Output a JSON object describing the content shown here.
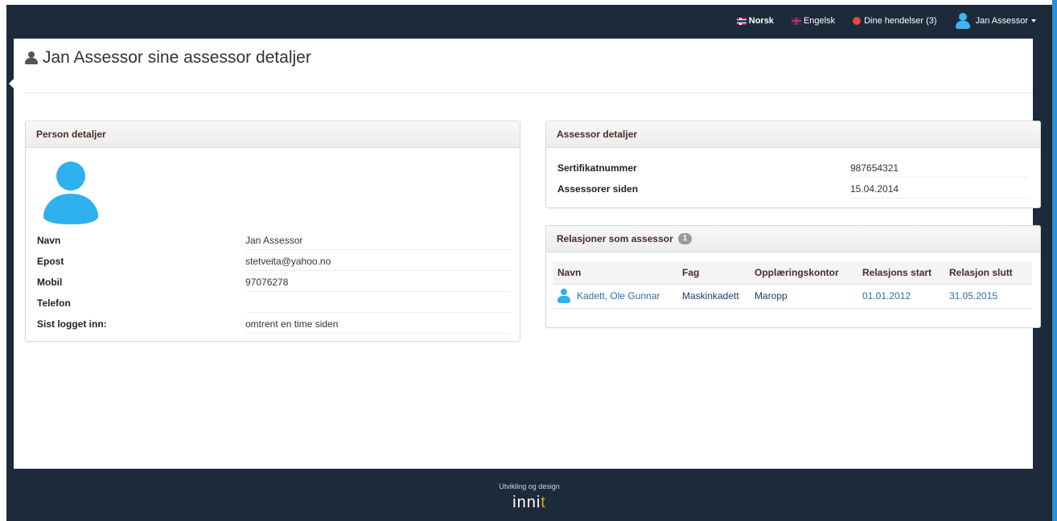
{
  "topbar": {
    "lang_norsk": "Norsk",
    "lang_engelsk": "Engelsk",
    "events": "Dine hendelser (3)",
    "user": "Jan Assessor"
  },
  "page": {
    "title": "Jan Assessor sine assessor detaljer"
  },
  "person": {
    "heading": "Person detaljer",
    "fields": [
      {
        "label": "Navn",
        "value": "Jan Assessor"
      },
      {
        "label": "Epost",
        "value": "stetveita@yahoo.no"
      },
      {
        "label": "Mobil",
        "value": "97076278"
      },
      {
        "label": "Telefon",
        "value": ""
      },
      {
        "label": "Sist logget inn:",
        "value": "omtrent en time siden"
      }
    ]
  },
  "assessor": {
    "heading": "Assessor detaljer",
    "fields": [
      {
        "label": "Sertifikatnummer",
        "value": "987654321"
      },
      {
        "label": "Assessorer siden",
        "value": "15.04.2014"
      }
    ]
  },
  "relations": {
    "heading": "Relasjoner som assessor",
    "count": "1",
    "columns": [
      "Navn",
      "Fag",
      "Opplæringskontor",
      "Relasjons start",
      "Relasjon slutt"
    ],
    "rows": [
      {
        "navn": "Kadett, Ole Gunnar",
        "fag": "Maskinkadett",
        "kontor": "Maropp",
        "start": "01.01.2012",
        "slutt": "31.05.2015"
      }
    ]
  },
  "footer": {
    "tagline": "Utvikling og design",
    "brand_main": "inni",
    "brand_accent": "t"
  },
  "colors": {
    "navbar": "#1c2a3a",
    "avatar": "#2fb0ef",
    "link": "#2f6ea8",
    "brand_accent": "#f39b1b"
  }
}
